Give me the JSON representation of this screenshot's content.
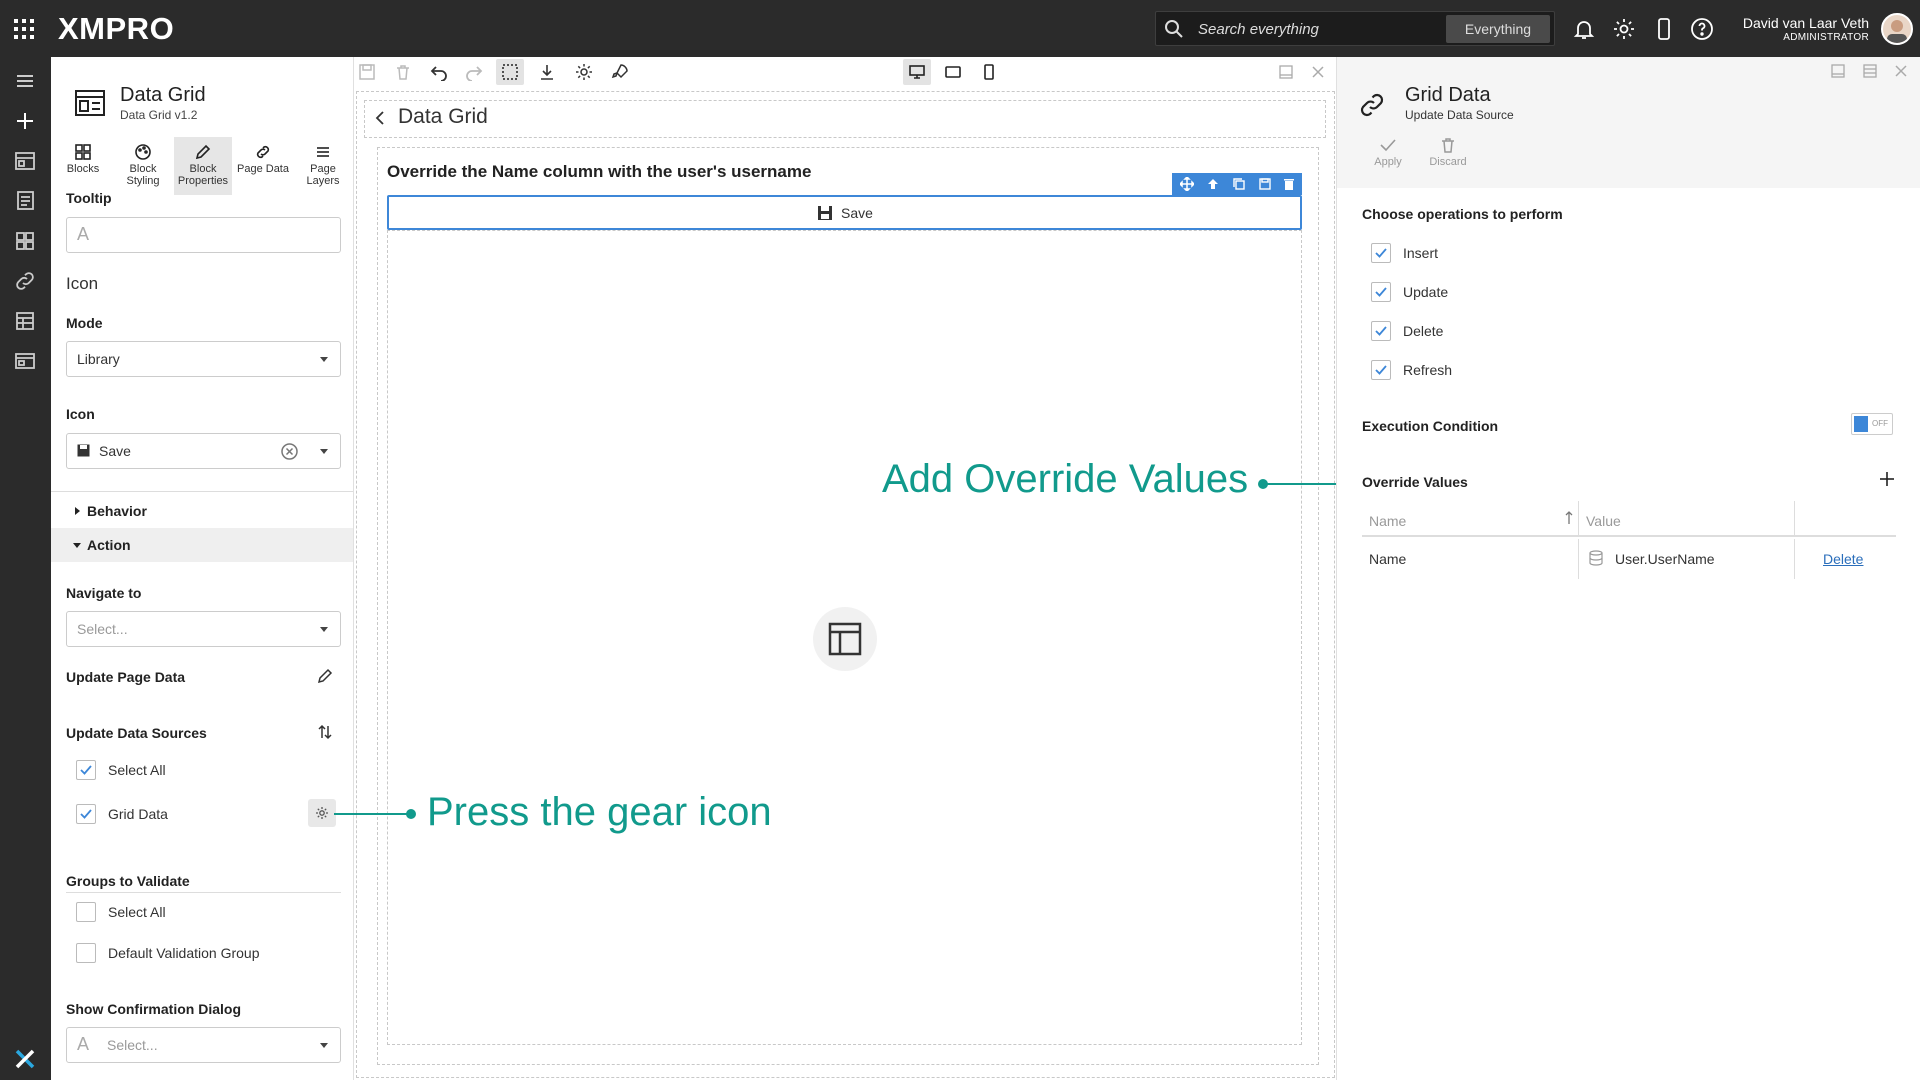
{
  "topbar": {
    "logo": "XMPRO",
    "search_placeholder": "Search everything",
    "search_scope": "Everything",
    "user_name": "David van Laar Veth",
    "user_role": "ADMINISTRATOR"
  },
  "left_panel": {
    "title": "Data Grid",
    "subtitle": "Data Grid v1.2",
    "tabs": [
      {
        "label": "Blocks"
      },
      {
        "label": "Block Styling"
      },
      {
        "label": "Block Properties"
      },
      {
        "label": "Page Data"
      },
      {
        "label": "Page Layers"
      }
    ],
    "tooltip_label": "Tooltip",
    "icon_heading": "Icon",
    "mode_label": "Mode",
    "mode_value": "Library",
    "icon_label": "Icon",
    "icon_value": "Save",
    "behavior_section": "Behavior",
    "action_section": "Action",
    "navigate_label": "Navigate to",
    "navigate_placeholder": "Select...",
    "update_page_data": "Update Page Data",
    "update_sources_label": "Update Data Sources",
    "update_sources": [
      {
        "label": "Select All",
        "checked": true
      },
      {
        "label": "Grid Data",
        "checked": true
      }
    ],
    "groups_label": "Groups to Validate",
    "groups": [
      {
        "label": "Select All",
        "checked": false
      },
      {
        "label": "Default Validation Group",
        "checked": false
      }
    ],
    "confirm_label": "Show Confirmation Dialog",
    "confirm_placeholder": "Select..."
  },
  "canvas": {
    "header_title": "Data Grid",
    "block_title": "Override the Name column with the user's username",
    "save_label": "Save"
  },
  "annotations": {
    "gear": "Press the gear icon",
    "override": "Add Override Values"
  },
  "right_panel": {
    "title": "Grid Data",
    "subtitle": "Update Data Source",
    "apply": "Apply",
    "discard": "Discard",
    "operations_label": "Choose operations to perform",
    "operations": [
      {
        "label": "Insert",
        "checked": true
      },
      {
        "label": "Update",
        "checked": true
      },
      {
        "label": "Delete",
        "checked": true
      },
      {
        "label": "Refresh",
        "checked": true
      }
    ],
    "execution_label": "Execution Condition",
    "execution_state": "OFF",
    "override_label": "Override Values",
    "table": {
      "headers": [
        "Name",
        "Value"
      ],
      "rows": [
        {
          "name": "Name",
          "value": "User.UserName",
          "action": "Delete"
        }
      ]
    }
  },
  "colors": {
    "accent": "#3d87d8",
    "annotation": "#119a8c",
    "chrome": "#2b2b2b"
  }
}
